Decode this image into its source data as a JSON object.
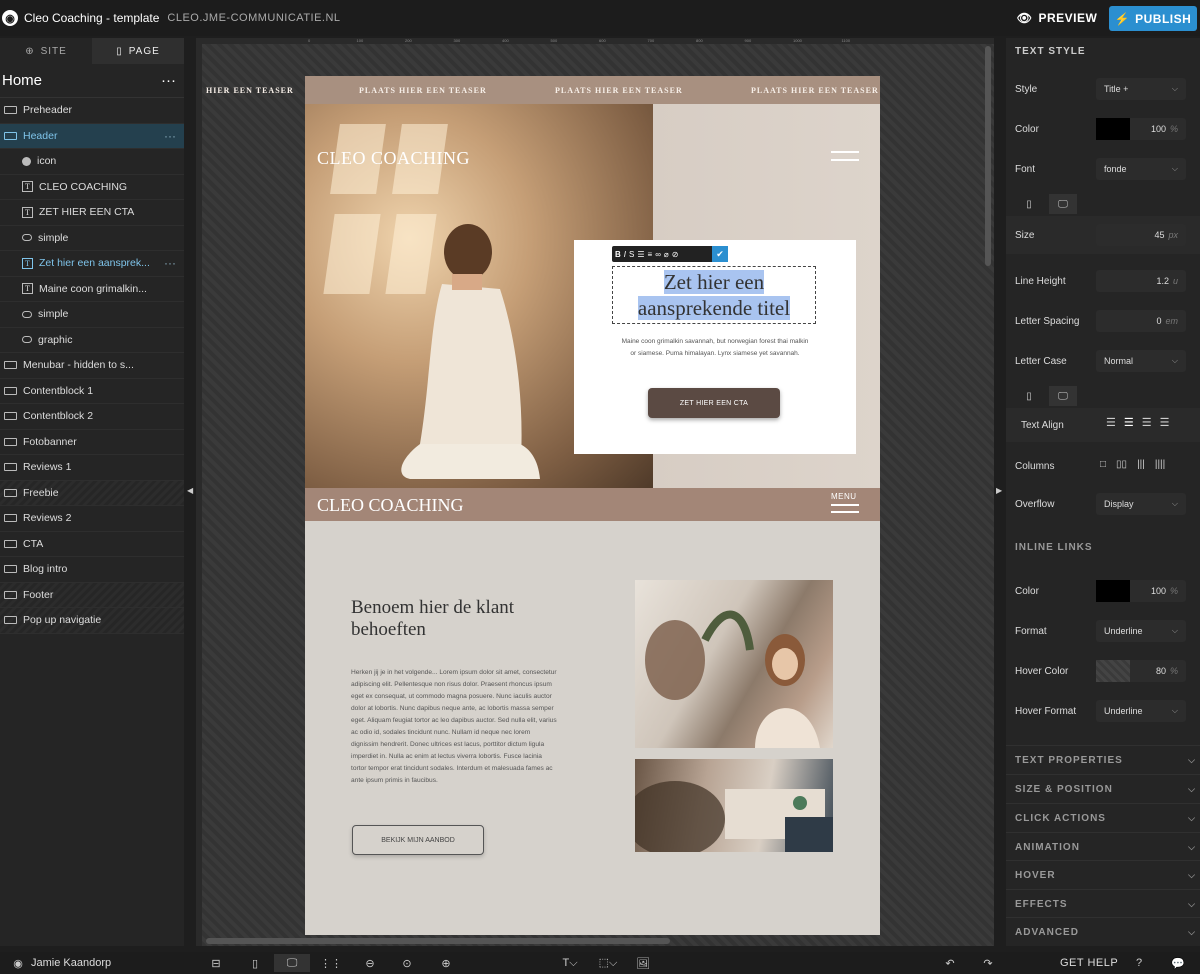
{
  "topbar": {
    "app_title": "Cleo Coaching - template",
    "domain": "CLEO.JME-COMMUNICATIE.NL",
    "preview_label": "PREVIEW",
    "publish_label": "PUBLISH",
    "accent_color": "#2b8fd0"
  },
  "leftpanel": {
    "tabs": [
      {
        "label": "SITE",
        "icon": "globe-icon"
      },
      {
        "label": "PAGE",
        "icon": "page-icon"
      }
    ],
    "page_name": "Home",
    "layers": [
      {
        "label": "Preheader",
        "icon": "section-icon"
      },
      {
        "label": "Header",
        "icon": "section-icon"
      },
      {
        "label": "icon",
        "icon": "emoji-icon"
      },
      {
        "label": "CLEO COACHING",
        "icon": "text-icon"
      },
      {
        "label": "ZET HIER EEN CTA",
        "icon": "text-icon"
      },
      {
        "label": "simple",
        "icon": "shape-icon"
      },
      {
        "label": "Zet hier een aansprek...",
        "icon": "text-icon"
      },
      {
        "label": "Maine coon grimalkin...",
        "icon": "text-icon"
      },
      {
        "label": "simple",
        "icon": "shape-icon"
      },
      {
        "label": "graphic",
        "icon": "shape-icon"
      },
      {
        "label": "Menubar - hidden to s...",
        "icon": "section-icon"
      },
      {
        "label": "Contentblock 1",
        "icon": "section-icon"
      },
      {
        "label": "Contentblock 2",
        "icon": "section-icon"
      },
      {
        "label": "Fotobanner",
        "icon": "section-icon"
      },
      {
        "label": "Reviews 1",
        "icon": "section-icon"
      },
      {
        "label": "Freebie",
        "icon": "section-icon"
      },
      {
        "label": "Reviews 2",
        "icon": "section-icon"
      },
      {
        "label": "CTA",
        "icon": "section-icon"
      },
      {
        "label": "Blog intro",
        "icon": "section-icon"
      },
      {
        "label": "Footer",
        "icon": "section-icon"
      },
      {
        "label": "Pop up navigatie",
        "icon": "section-icon"
      }
    ]
  },
  "canvas": {
    "ruler_marks": [
      "0",
      "100",
      "200",
      "300",
      "400",
      "500",
      "600",
      "700",
      "800",
      "900",
      "1000",
      "1100"
    ],
    "teasers": [
      "HIER EEN TEASER",
      "PLAATS HIER EEN TEASER",
      "PLAATS HIER EEN TEASER",
      "PLAATS HIER EEN TEASER"
    ],
    "site_logo": "CLEO COACHING",
    "hero_title": "Zet hier een aansprekende titel",
    "hero_text": "Maine coon grimalkin savannah, but norwegian forest thai malkin or siamese. Puma himalayan. Lynx siamese yet savannah.",
    "hero_cta": "ZET HIER EEN CTA",
    "menubar_logo": "CLEO COACHING",
    "menu_label": "MENU",
    "content_heading": "Benoem hier de klant behoeften",
    "content_text": "Herken jij je in het volgende... Lorem ipsum dolor sit amet, consectetur adipiscing elit. Pellentesque non risus dolor. Praesent rhoncus ipsum eget ex consequat, ut commodo magna posuere. Nunc iaculis auctor dolor at lobortis. Nunc dapibus neque ante, ac lobortis massa semper eget. Aliquam feugiat tortor ac leo dapibus auctor. Sed nulla elit, varius ac odio id, sodales tincidunt nunc. Nullam id neque nec lorem dignissim hendrerit. Donec ultrices est lacus, porttitor dictum ligula imperdiet in. Nulla ac enim at lectus viverra lobortis. Fusce lacinia tortor tempor erat tincidunt sodales. Interdum et malesuada fames ac ante ipsum primis in faucibus.",
    "content_button": "BEKIJK MIJN AANBOD"
  },
  "rightpanel": {
    "header": "TEXT STYLE",
    "style_label": "Style",
    "style_value": "Title +",
    "color_label": "Color",
    "color_opacity": "100",
    "color_unit": "%",
    "font_label": "Font",
    "font_value": "fonde",
    "size_label": "Size",
    "size_value": "45",
    "size_unit": "px",
    "line_height_label": "Line Height",
    "line_height_value": "1.2",
    "line_height_unit": "u",
    "letter_spacing_label": "Letter Spacing",
    "letter_spacing_value": "0",
    "letter_spacing_unit": "em",
    "letter_case_label": "Letter Case",
    "letter_case_value": "Normal",
    "text_align_label": "Text Align",
    "columns_label": "Columns",
    "overflow_label": "Overflow",
    "overflow_value": "Display",
    "inline_links_header": "INLINE LINKS",
    "link_color_label": "Color",
    "link_color_opacity": "100",
    "link_color_unit": "%",
    "format_label": "Format",
    "format_value": "Underline",
    "hover_color_label": "Hover Color",
    "hover_color_opacity": "80",
    "hover_color_unit": "%",
    "hover_format_label": "Hover Format",
    "hover_format_value": "Underline",
    "sections": [
      "TEXT PROPERTIES",
      "SIZE & POSITION",
      "CLICK ACTIONS",
      "ANIMATION",
      "HOVER",
      "EFFECTS",
      "ADVANCED"
    ]
  },
  "bottombar": {
    "user_name": "Jamie Kaandorp",
    "help_label": "GET HELP"
  }
}
